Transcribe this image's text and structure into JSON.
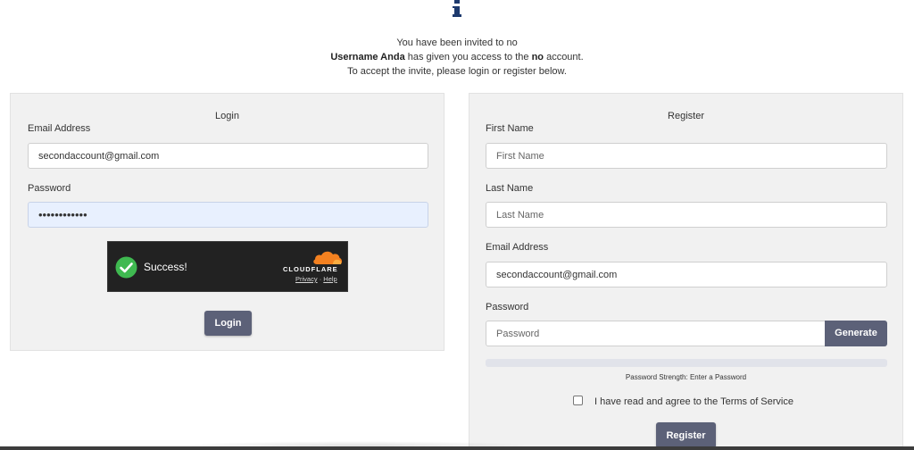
{
  "invite": {
    "line1": "You have been invited to no",
    "inviter": "Username Anda",
    "line2_mid": " has given you access to the ",
    "account": "no",
    "line2_end": " account.",
    "line3": "To accept the invite, please login or register below."
  },
  "login": {
    "title": "Login",
    "email_label": "Email Address",
    "email_value": "secondaccount@gmail.com",
    "password_label": "Password",
    "password_value": "••••••••••••",
    "button": "Login",
    "captcha": {
      "status": "Success!",
      "brand": "CLOUDFLARE",
      "privacy": "Privacy",
      "separator": "·",
      "help": "Help"
    }
  },
  "register": {
    "title": "Register",
    "first_name_label": "First Name",
    "first_name_placeholder": "First Name",
    "last_name_label": "Last Name",
    "last_name_placeholder": "Last Name",
    "email_label": "Email Address",
    "email_value": "secondaccount@gmail.com",
    "password_label": "Password",
    "password_placeholder": "Password",
    "generate_button": "Generate",
    "strength_text": "Password Strength: Enter a Password",
    "strength_level": 0,
    "tos_label": "I have read and agree to the Terms of Service",
    "tos_checked": false,
    "button": "Register"
  },
  "icons": {
    "info": "info-icon",
    "check": "check-circle-icon",
    "cloud": "cloudflare-cloud-icon"
  },
  "colors": {
    "button": "#5c6178",
    "panel": "#f1f1f1",
    "autofill": "#e8f0fe",
    "success": "#3fb950",
    "cloudflare_orange": "#f48120"
  }
}
